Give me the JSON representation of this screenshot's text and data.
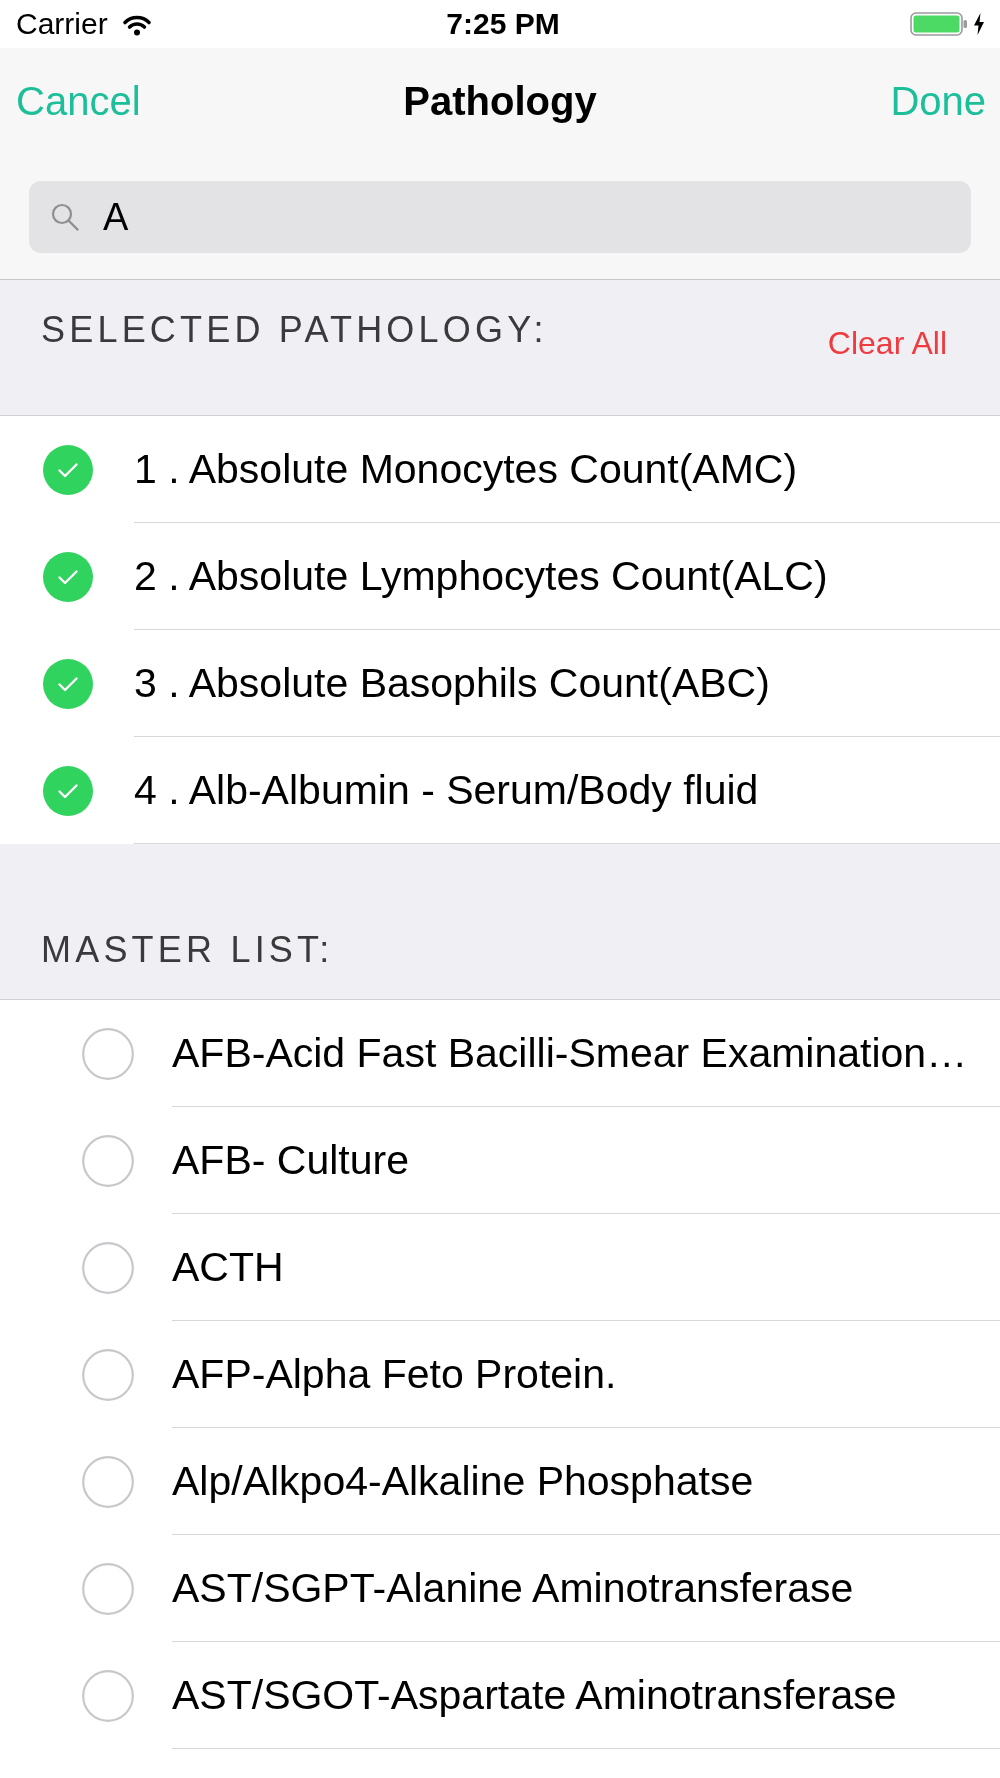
{
  "status_bar": {
    "carrier": "Carrier",
    "time": "7:25 PM"
  },
  "nav_bar": {
    "left_button": "Cancel",
    "title": "Pathology",
    "right_button": "Done"
  },
  "search": {
    "value": "A"
  },
  "selected_section": {
    "header": "SELECTED PATHOLOGY:",
    "action": "Clear All",
    "items": [
      {
        "label": "1 . Absolute Monocytes Count(AMC)",
        "checked": true
      },
      {
        "label": "2 . Absolute Lymphocytes Count(ALC)",
        "checked": true
      },
      {
        "label": "3 . Absolute Basophils Count(ABC)",
        "checked": true
      },
      {
        "label": "4 . Alb-Albumin - Serum/Body fluid",
        "checked": true
      }
    ]
  },
  "master_list": {
    "header": "MASTER LIST:",
    "items": [
      {
        "label": "AFB-Acid Fast Bacilli-Smear Examination…",
        "checked": false
      },
      {
        "label": "AFB- Culture",
        "checked": false
      },
      {
        "label": "ACTH",
        "checked": false
      },
      {
        "label": "AFP-Alpha Feto Protein.",
        "checked": false
      },
      {
        "label": "Alp/Alkpo4-Alkaline Phosphatse",
        "checked": false
      },
      {
        "label": "AST/SGPT-Alanine Aminotransferase",
        "checked": false
      },
      {
        "label": "AST/SGOT-Aspartate Aminotransferase",
        "checked": false
      }
    ]
  }
}
